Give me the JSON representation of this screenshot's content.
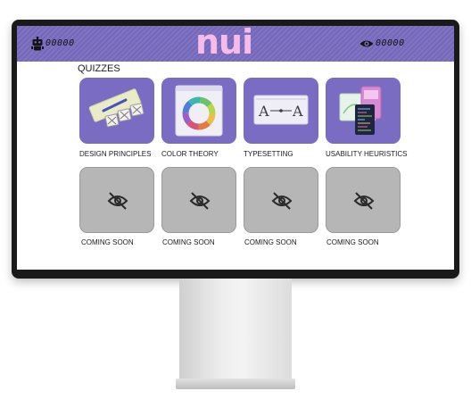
{
  "header": {
    "left_code": "00000",
    "logo_text": "nui",
    "right_code": "00000"
  },
  "quizzes": {
    "title": "QUIZZES",
    "items": [
      {
        "label": "DESIGN PRINCIPLES",
        "icon": "design-principles-icon"
      },
      {
        "label": "COLOR THEORY",
        "icon": "color-wheel-icon"
      },
      {
        "label": "TYPESETTING",
        "icon": "typesetting-icon"
      },
      {
        "label": "USABILITY HEURISTICS",
        "icon": "devices-icon"
      }
    ],
    "locked": [
      {
        "label": "COMING SOON",
        "icon": "eye-off-icon"
      },
      {
        "label": "COMING SOON",
        "icon": "eye-off-icon"
      },
      {
        "label": "COMING SOON",
        "icon": "eye-off-icon"
      },
      {
        "label": "COMING SOON",
        "icon": "eye-off-icon"
      }
    ]
  },
  "colors": {
    "header": "#7a6cc0",
    "card": "#7b6cc3",
    "logo": "#f6bce9",
    "locked_card": "#b6b6b6"
  }
}
